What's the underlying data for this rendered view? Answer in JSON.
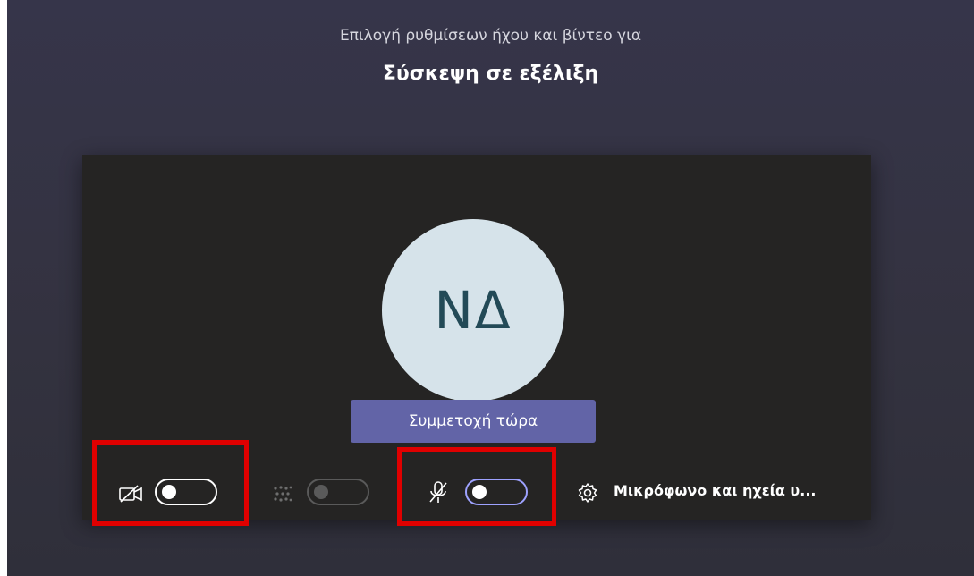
{
  "header": {
    "subtitle": "Επιλογή ρυθμίσεων ήχου και βίντεο για",
    "title": "Σύσκεψη σε εξέλιξη"
  },
  "preview": {
    "avatar_initials": "ΝΔ"
  },
  "actions": {
    "join_label": "Συμμετοχή τώρα"
  },
  "controls": {
    "camera": {
      "icon": "camera-off-icon",
      "state": "off"
    },
    "background_blur": {
      "icon": "background-blur-icon",
      "state": "disabled"
    },
    "microphone": {
      "icon": "mic-off-icon",
      "state": "off"
    },
    "device_settings": {
      "icon": "gear-icon",
      "label": "Μικρόφωνο και ηχεία υ..."
    }
  },
  "colors": {
    "background": "#36354a",
    "preview": "#252423",
    "accent": "#6264a7",
    "avatar": "#d6e3ea",
    "highlight": "#e00000"
  }
}
